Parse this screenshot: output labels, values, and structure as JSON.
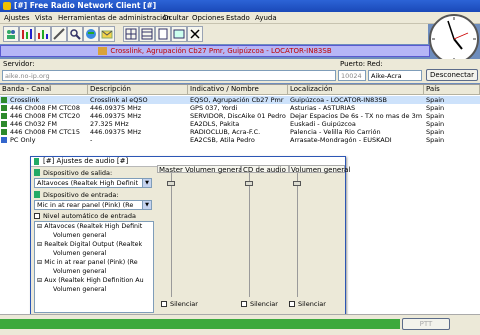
{
  "title": "[#] Free Radio Network Client [#]",
  "menu": [
    "Ajustes",
    "Vista",
    "Herramientas de administración",
    "Ocultar",
    "Opciones",
    "Estado",
    "Ayuda"
  ],
  "connection": "Crosslink, Agrupación Cb27 Pmr, Guipúzcoa - LOCATOR-IN83SB",
  "server": {
    "label": "Servidor:",
    "value": "aike.no-ip.org",
    "port_label": "Puerto:",
    "port": "10024",
    "net_label": "Red:",
    "net": "Aike-Acra",
    "disconnect": "Desconectar"
  },
  "table": {
    "headers": [
      "Banda - Canal",
      "Descripción",
      "Indicativo / Nombre",
      "Localización",
      "País"
    ],
    "rows": [
      {
        "c": [
          "Crosslink",
          "Crosslink al eQSO",
          "EQSO, Agrupación Cb27 Pmr",
          "Guipúzcoa - LOCATOR-IN83SB",
          "Spain"
        ]
      },
      {
        "c": [
          "446 Ch008 FM CTC08",
          "446.09375 MHz",
          "GPS 037, Yordi",
          "Asturias - ASTURIAS",
          "Spain"
        ]
      },
      {
        "c": [
          "446 Ch008 FM CTC20",
          "446.09375 MHz",
          "SERVIDOR, DiscAike 01 Pedro",
          "Dejar Espacios De 6s - TX no mas de 3m",
          "Spain"
        ]
      },
      {
        "c": [
          "446 Ch032 FM",
          "27.325 MHz",
          "EA2DLS, Pakita",
          "Euskadi - Guipúzcoa",
          "Spain"
        ]
      },
      {
        "c": [
          "446 Ch008 FM CTC15",
          "446.09375 MHz",
          "RADIOCLUB, Acra-F.C.",
          "Palencia - Velilla Rio Carrión",
          "Spain"
        ]
      },
      {
        "c": [
          "PC Only",
          "-",
          "EA2CSB, Atila Pedro",
          "Arrasate-Mondragón - EUSKADI",
          "Spain"
        ]
      }
    ]
  },
  "audio": {
    "title": "[#] Ajustes de audio [#]",
    "out_label": "Dispositivo de salida:",
    "out_value": "Altavoces (Realtek High Definit",
    "in_label": "Dispositivo de entrada:",
    "in_value": "Mic in at rear panel (Pink) (Re",
    "agc_label": "Nivel automático de entrada",
    "tree": [
      "Altavoces (Realtek High Definit",
      "Volumen general",
      "Realtek Digital Output (Realtek",
      "Volumen general",
      "Mic in at rear panel (Pink) (Re",
      "Volumen general",
      "Aux (Realtek High Definition Au",
      "Volumen general"
    ],
    "panels": [
      "Master Volumen general",
      "CD de audio",
      "Volumen general"
    ],
    "mute": "Silenciar"
  },
  "status": {
    "ptt": "PTT"
  }
}
